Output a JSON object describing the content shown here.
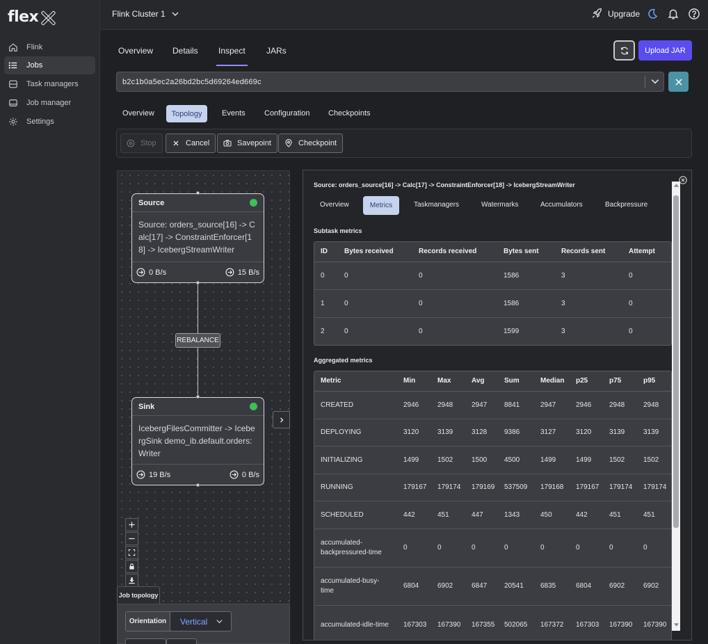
{
  "app": {
    "logo_text": "flex"
  },
  "sidebar": {
    "items": [
      {
        "label": "Flink",
        "icon": "home-icon"
      },
      {
        "label": "Jobs",
        "icon": "list-icon",
        "active": true
      },
      {
        "label": "Task managers",
        "icon": "database-icon"
      },
      {
        "label": "Job manager",
        "icon": "server-icon"
      },
      {
        "label": "Settings",
        "icon": "gear-icon"
      }
    ]
  },
  "header": {
    "cluster": "Flink Cluster 1",
    "upgrade": "Upgrade",
    "icons": [
      "rocket-icon",
      "moon-icon",
      "bell-icon",
      "help-icon"
    ]
  },
  "main_tabs": {
    "items": [
      "Overview",
      "Details",
      "Inspect",
      "JARs"
    ],
    "active": "Inspect",
    "upload": "Upload JAR"
  },
  "job": {
    "id": "b2c1b0a5ec2a26bd2bc5d69264ed669c"
  },
  "sub_tabs": {
    "items": [
      "Overview",
      "Topology",
      "Events",
      "Configuration",
      "Checkpoints"
    ],
    "active": "Topology"
  },
  "actions": {
    "stop": "Stop",
    "cancel": "Cancel",
    "savepoint": "Savepoint",
    "checkpoint": "Checkpoint"
  },
  "topology": {
    "source": {
      "title": "Source",
      "body": "Source: orders_source[16] -> Calc[17] -> ConstraintEnforcer[18] -> IcebergStreamWriter",
      "in": "0 B/s",
      "out": "15 B/s",
      "status_color": "#3fbf55"
    },
    "edge_label": "REBALANCE",
    "sink": {
      "title": "Sink",
      "body": "IcebergFilesCommitter -> IcebergSink demo_ib.default.orders: Writer",
      "in": "19 B/s",
      "out": "0 B/s",
      "status_color": "#3fbf55"
    },
    "label": "Job topology",
    "orientation_label": "Orientation",
    "orientation_value": "Vertical"
  },
  "details": {
    "title": "Source: orders_source[16] -> Calc[17] -> ConstraintEnforcer[18] -> IcebergStreamWriter",
    "tabs": [
      "Overview",
      "Metrics",
      "Taskmanagers",
      "Watermarks",
      "Accumulators",
      "Backpressure"
    ],
    "active_tab": "Metrics",
    "subtask_title": "Subtask metrics",
    "subtask_headers": [
      "ID",
      "Bytes received",
      "Records received",
      "Bytes sent",
      "Records sent",
      "Attempt"
    ],
    "subtask_rows": [
      [
        "0",
        "0",
        "0",
        "1586",
        "3",
        "0"
      ],
      [
        "1",
        "0",
        "0",
        "1586",
        "3",
        "0"
      ],
      [
        "2",
        "0",
        "0",
        "1599",
        "3",
        "0"
      ]
    ],
    "agg_title": "Aggregated metrics",
    "agg_headers": [
      "Metric",
      "Min",
      "Max",
      "Avg",
      "Sum",
      "Median",
      "p25",
      "p75",
      "p95"
    ],
    "agg_rows": [
      [
        "CREATED",
        "2946",
        "2948",
        "2947",
        "8841",
        "2947",
        "2946",
        "2948",
        "2948"
      ],
      [
        "DEPLOYING",
        "3120",
        "3139",
        "3128",
        "9386",
        "3127",
        "3120",
        "3139",
        "3139"
      ],
      [
        "INITIALIZING",
        "1499",
        "1502",
        "1500",
        "4500",
        "1499",
        "1499",
        "1502",
        "1502"
      ],
      [
        "RUNNING",
        "179167",
        "179174",
        "179169",
        "537509",
        "179168",
        "179167",
        "179174",
        "179174"
      ],
      [
        "SCHEDULED",
        "442",
        "451",
        "447",
        "1343",
        "450",
        "442",
        "451",
        "451"
      ],
      [
        "accumulated-backpressured-time",
        "0",
        "0",
        "0",
        "0",
        "0",
        "0",
        "0",
        "0"
      ],
      [
        "accumulated-busy-time",
        "6804",
        "6902",
        "6847",
        "20541",
        "6835",
        "6804",
        "6902",
        "6902"
      ],
      [
        "accumulated-idle-time",
        "167303",
        "167390",
        "167355",
        "502065",
        "167372",
        "167303",
        "167390",
        "167390"
      ]
    ]
  },
  "colors": {
    "accent": "#5a4df0",
    "active_tab_bg": "#c6d3ef",
    "status_ok": "#3fbf55",
    "close_btn": "#4b93a4"
  }
}
